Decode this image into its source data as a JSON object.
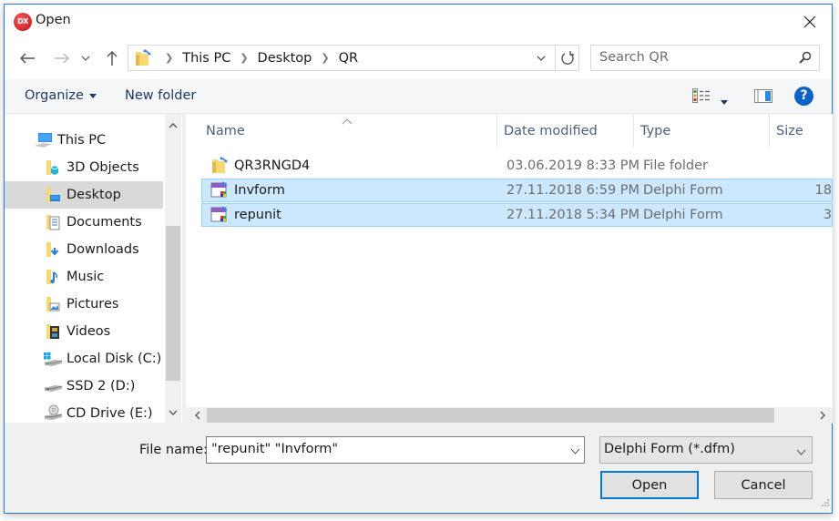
{
  "window": {
    "title": "Open",
    "app_icon_text": "DX"
  },
  "nav": {
    "back": "Back",
    "forward": "Forward",
    "recent": "Recent locations",
    "up": "Up"
  },
  "address": {
    "crumbs": [
      "This PC",
      "Desktop",
      "QR"
    ]
  },
  "search": {
    "placeholder": "Search QR"
  },
  "toolbar": {
    "organize_label": "Organize",
    "new_folder_label": "New folder",
    "help_label": "?"
  },
  "sidebar": {
    "items": [
      {
        "label": "This PC",
        "icon": "pc-icon"
      },
      {
        "label": "3D Objects",
        "icon": "3d-objects-folder-icon"
      },
      {
        "label": "Desktop",
        "icon": "desktop-folder-icon",
        "selected": true
      },
      {
        "label": "Documents",
        "icon": "documents-folder-icon"
      },
      {
        "label": "Downloads",
        "icon": "downloads-folder-icon"
      },
      {
        "label": "Music",
        "icon": "music-folder-icon"
      },
      {
        "label": "Pictures",
        "icon": "pictures-folder-icon"
      },
      {
        "label": "Videos",
        "icon": "videos-folder-icon"
      },
      {
        "label": "Local Disk (C:)",
        "icon": "windows-drive-icon"
      },
      {
        "label": "SSD 2 (D:)",
        "icon": "drive-icon"
      },
      {
        "label": "CD Drive (E:)",
        "icon": "cd-drive-icon"
      }
    ]
  },
  "files": {
    "columns": [
      "Name",
      "Date modified",
      "Type",
      "Size"
    ],
    "rows": [
      {
        "name": "QR3RNGD4",
        "date": "03.06.2019 8:33 PM",
        "type": "File folder",
        "size": "",
        "icon": "folder-icon",
        "selected": false
      },
      {
        "name": "Invform",
        "date": "27.11.2018 6:59 PM",
        "type": "Delphi Form",
        "size": "18",
        "icon": "delphi-form-icon",
        "selected": true
      },
      {
        "name": "repunit",
        "date": "27.11.2018 5:34 PM",
        "type": "Delphi Form",
        "size": "3",
        "icon": "delphi-form-icon",
        "selected": true
      }
    ]
  },
  "footer": {
    "file_name_label": "File name:",
    "file_name_value": "\"repunit\" \"Invform\"",
    "file_type_value": "Delphi Form (*.dfm)",
    "open_label": "Open",
    "cancel_label": "Cancel"
  },
  "colors": {
    "accent": "#0078d7",
    "selection_bg": "#cce8ff",
    "selection_border": "#99d1ff",
    "help_blue": "#0c63c6",
    "app_icon_red": "#c21414"
  }
}
